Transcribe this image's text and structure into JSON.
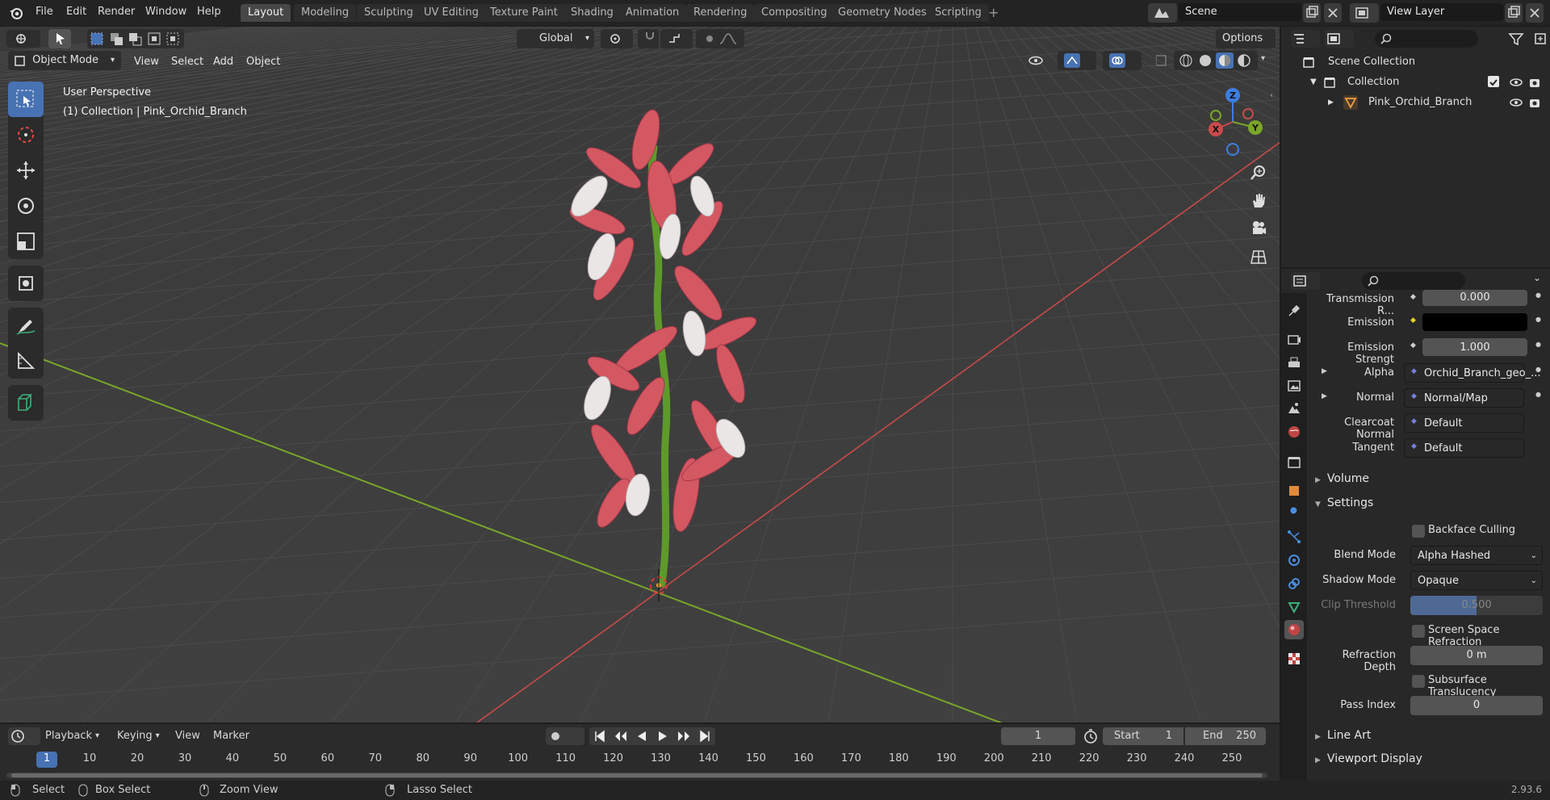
{
  "menubar": {
    "items": [
      "File",
      "Edit",
      "Render",
      "Window",
      "Help"
    ],
    "workspaces": [
      "Layout",
      "Modeling",
      "Sculpting",
      "UV Editing",
      "Texture Paint",
      "Shading",
      "Animation",
      "Rendering",
      "Compositing",
      "Geometry Nodes",
      "Scripting"
    ],
    "add_tab": "+",
    "scene": "Scene",
    "view_layer": "View Layer"
  },
  "viewport": {
    "transform_orientation": "Global",
    "options_label": "Options",
    "mode": "Object Mode",
    "menus": [
      "View",
      "Select",
      "Add",
      "Object"
    ],
    "overlay_title": "User Perspective",
    "overlay_sub": "(1) Collection | Pink_Orchid_Branch",
    "gizmo": {
      "x": "X",
      "y": "Y",
      "z": "Z"
    }
  },
  "timeline": {
    "menus": [
      "Playback",
      "Keying",
      "View",
      "Marker"
    ],
    "current_frame": "1",
    "start_label": "Start",
    "start": "1",
    "end_label": "End",
    "end": "250",
    "ticks": [
      "1",
      "10",
      "20",
      "30",
      "40",
      "50",
      "60",
      "70",
      "80",
      "90",
      "100",
      "110",
      "120",
      "130",
      "140",
      "150",
      "160",
      "170",
      "180",
      "190",
      "200",
      "210",
      "220",
      "230",
      "240",
      "250"
    ]
  },
  "statusbar": {
    "items": [
      "Select",
      "Box Select",
      "Zoom View",
      "Lasso Select"
    ],
    "version": "2.93.6"
  },
  "outliner": {
    "scene_collection": "Scene Collection",
    "collection": "Collection",
    "object": "Pink_Orchid_Branch"
  },
  "properties": {
    "rows": [
      {
        "label": "Transmission R...",
        "value": "0.000"
      },
      {
        "label": "Emission",
        "value": ""
      },
      {
        "label": "Emission Strengt",
        "value": "1.000"
      },
      {
        "label": "Alpha",
        "value": "Orchid_Branch_geo_..."
      },
      {
        "label": "Normal",
        "value": "Normal/Map"
      },
      {
        "label": "Clearcoat Normal",
        "value": "Default"
      },
      {
        "label": "Tangent",
        "value": "Default"
      }
    ],
    "volume": "Volume",
    "settings": "Settings",
    "backface_culling": "Backface Culling",
    "blend_mode_label": "Blend Mode",
    "blend_mode": "Alpha Hashed",
    "shadow_mode_label": "Shadow Mode",
    "shadow_mode": "Opaque",
    "clip_threshold_label": "Clip Threshold",
    "clip_threshold": "0.500",
    "screen_space_refraction": "Screen Space Refraction",
    "refraction_depth_label": "Refraction Depth",
    "refraction_depth": "0 m",
    "subsurface_translucency": "Subsurface Translucency",
    "pass_index_label": "Pass Index",
    "pass_index": "0",
    "line_art": "Line Art",
    "viewport_display": "Viewport Display"
  },
  "colors": {
    "accent": "#4772b3",
    "x_axis": "#c94a4a",
    "y_axis": "#7aa62a",
    "z_axis": "#3d7ee0",
    "petal": "#d35862"
  }
}
